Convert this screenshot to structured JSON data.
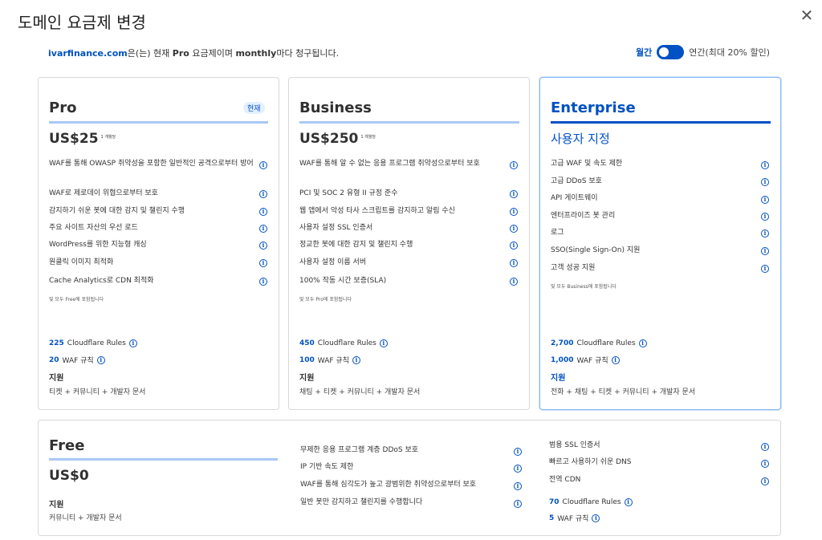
{
  "dialog": {
    "title": "도메인 요금제 변경",
    "close_icon": "✕",
    "subtitle": {
      "domain": "ivarfinance.com",
      "text1": "은(는) 현재 ",
      "plan": "Pro",
      "text2": " 요금제이며 ",
      "cycle": "monthly",
      "text3": "마다 청구됩니다."
    },
    "billing": {
      "monthly": "월간",
      "annual": "연간(최대 20% 할인)"
    }
  },
  "colors": {
    "accent": "#0051c3",
    "bar_light": "#a9c8f5"
  },
  "plans": {
    "pro": {
      "name": "Pro",
      "badge": "현재",
      "price": "US$25",
      "unit": "1 개월당",
      "features": [
        "WAF를 통해 OWASP 취약성을 포함한 일반적인 공격으로부터 방어",
        "WAF로 제로데이 위협으로부터 보호",
        "감지하기 쉬운 봇에 대한 감지 및 챌린지 수행",
        "주요 사이트 자산의 우선 로드",
        "WordPress를 위한 지능형 캐싱",
        "원클릭 이미지 최적화",
        "Cache Analytics로 CDN 최적화"
      ],
      "included": "및 모두 Free에 포함됩니다",
      "rules_n": "225",
      "rules_label": "Cloudflare Rules",
      "waf_n": "20",
      "waf_label": "WAF 규칙",
      "support_title": "지원",
      "support_desc": "티켓 + 커뮤니티 + 개발자 문서"
    },
    "business": {
      "name": "Business",
      "price": "US$250",
      "unit": "1 개월당",
      "features": [
        "WAF를 통해 알 수 없는 응용 프로그램 취약성으로부터 보호",
        "PCI 및 SOC 2 유형 II 규정 준수",
        "웹 앱에서 악성 타사 스크립트를 감지하고 알림 수신",
        "사용자 설정 SSL 인증서",
        "정교한 봇에 대한 감지 및 챌린지 수행",
        "사용자 설정 이름 서버",
        "100% 작동 시간 보증(SLA)"
      ],
      "included": "및 모두 Pro에 포함됩니다",
      "rules_n": "450",
      "rules_label": "Cloudflare Rules",
      "waf_n": "100",
      "waf_label": "WAF 규칙",
      "support_title": "지원",
      "support_desc": "채팅 + 티켓 + 커뮤니티 + 개발자 문서"
    },
    "enterprise": {
      "name": "Enterprise",
      "custom": "사용자 지정",
      "features": [
        "고급 WAF 및 속도 제한",
        "고급 DDoS 보호",
        "API 게이트웨이",
        "엔터프라이즈 봇 관리",
        "로그",
        "SSO(Single Sign-On) 지원",
        "고객 성공 지원"
      ],
      "included": "및 모두 Business에 포함됩니다",
      "rules_n": "2,700",
      "rules_label": "Cloudflare Rules",
      "waf_n": "1,000",
      "waf_label": "WAF 규칙",
      "support_title": "지원",
      "support_desc": "전화 + 채팅 + 티켓 + 커뮤니티 + 개발자 문서"
    },
    "free": {
      "name": "Free",
      "price": "US$0",
      "support_title": "지원",
      "support_desc": "커뮤니티 + 개발자 문서",
      "features_col1": [
        "무제한 응용 프로그램 계층 DDoS 보호",
        "IP 기반 속도 제한",
        "WAF를 통해 심각도가 높고 광범위한 취약성으로부터 보호",
        "일반 봇만 감지하고 챌린지를 수행합니다"
      ],
      "features_col2": [
        "범용 SSL 인증서",
        "빠르고 사용하기 쉬운 DNS",
        "전역 CDN"
      ],
      "rules_n": "70",
      "rules_label": "Cloudflare Rules",
      "waf_n": "5",
      "waf_label": "WAF 규칙"
    }
  },
  "info_icon": "i"
}
